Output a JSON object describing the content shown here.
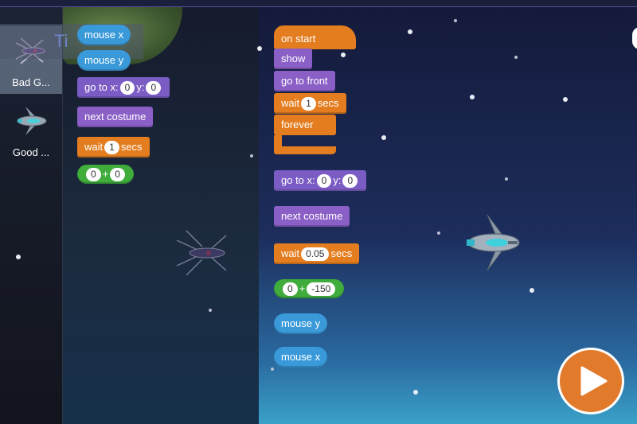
{
  "sprites": [
    {
      "name": "Bad G...",
      "selected": true
    },
    {
      "name": "Good ..."
    }
  ],
  "tooltip": {
    "text": "Ti"
  },
  "palette_blocks": {
    "mouse_x": "mouse x",
    "mouse_y": "mouse y",
    "goto_label": "go to x:",
    "goto_x": "0",
    "goto_y_label": "y:",
    "goto_y": "0",
    "next_costume": "next costume",
    "wait_label": "wait",
    "wait_value": "1",
    "wait_unit": "secs",
    "add_a": "0",
    "add_op": "+",
    "add_b": "0"
  },
  "script": {
    "hat": "on start",
    "show": "show",
    "go_to_front": "go to front",
    "wait_label": "wait",
    "wait_value": "1",
    "wait_unit": "secs",
    "forever": "forever",
    "goto_label": "go to x:",
    "goto_x": "0",
    "goto_y_label": "y:",
    "goto_y": "0",
    "next_costume": "next costume",
    "wait2_label": "wait",
    "wait2_value": "0.05",
    "wait2_unit": "secs",
    "add_a": "0",
    "add_op": "+",
    "add_b": "-150",
    "mouse_y": "mouse y",
    "mouse_x": "mouse x"
  },
  "colors": {
    "motion": "#7b5cc4",
    "looks": "#8a5fc6",
    "control": "#e37d1f",
    "sensing": "#3a9ad9",
    "operators": "#3fac3c",
    "play": "#e27a2c"
  },
  "icons": [
    "bad-spaceship-icon",
    "good-spaceship-icon",
    "play-icon"
  ]
}
